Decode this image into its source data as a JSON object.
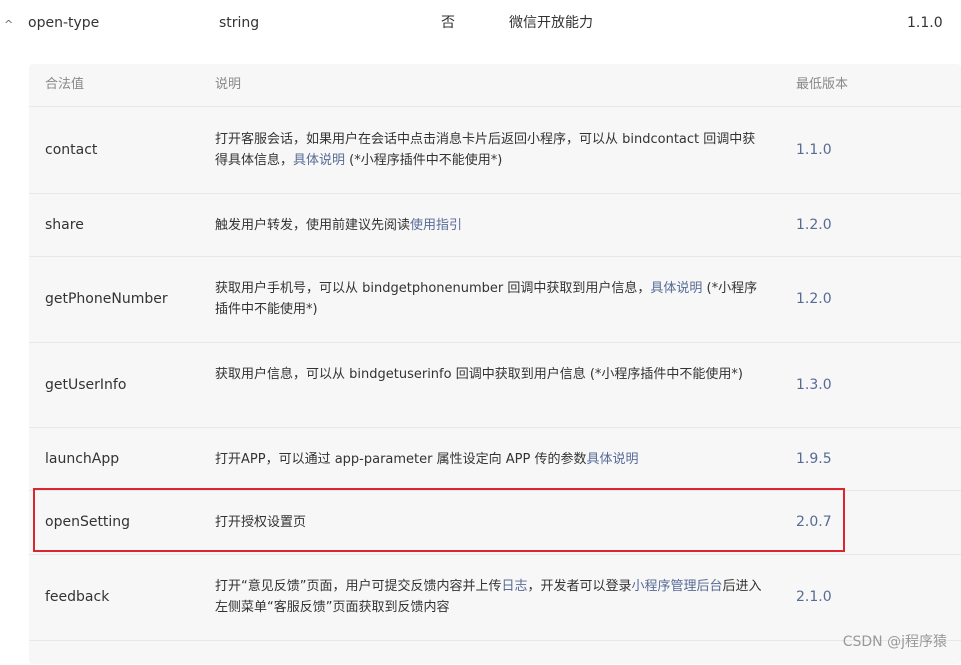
{
  "property_row": {
    "expand_glyph": "^",
    "name": "open-type",
    "type": "string",
    "required": "否",
    "description": "微信开放能力",
    "version": "1.1.0"
  },
  "table": {
    "headers": {
      "value": "合法值",
      "desc": "说明",
      "version": "最低版本"
    },
    "rows": [
      {
        "name": "contact",
        "version": "1.1.0",
        "desc_a": "打开客服会话，如果用户在会话中点击消息卡片后返回小程序，可以从 bindcontact 回调中获得具体信息，",
        "link_a": "具体说明",
        "desc_b": " (*小程序插件中不能使用*)"
      },
      {
        "name": "share",
        "version": "1.2.0",
        "desc_a": "触发用户转发，使用前建议先阅读",
        "link_a": "使用指引"
      },
      {
        "name": "getPhoneNumber",
        "version": "1.2.0",
        "desc_a": "获取用户手机号，可以从 bindgetphonenumber 回调中获取到用户信息，",
        "link_a": "具体说明",
        "desc_b": " (*小程序插件中不能使用*)"
      },
      {
        "name": "getUserInfo",
        "version": "1.3.0",
        "desc_a": "获取用户信息，可以从 bindgetuserinfo 回调中获取到用户信息 (*小程序插件中不能使用*)"
      },
      {
        "name": "launchApp",
        "version": "1.9.5",
        "desc_a": "打开APP，可以通过 app-parameter 属性设定向 APP 传的参数",
        "link_a": "具体说明"
      },
      {
        "name": "openSetting",
        "version": "2.0.7",
        "desc_a": "打开授权设置页"
      },
      {
        "name": "feedback",
        "version": "2.1.0",
        "desc_a": "打开“意见反馈”页面，用户可提交反馈内容并上传",
        "link_a": "日志",
        "desc_b": "，开发者可以登录",
        "link_b": "小程序管理后台",
        "desc_c": "后进入左侧菜单“客服反馈”页面获取到反馈内容"
      }
    ]
  },
  "watermark": "CSDN @j程序猿",
  "colors": {
    "link": "#576b95",
    "highlight": "#d9262f",
    "panel_bg": "#f7f7f7"
  }
}
